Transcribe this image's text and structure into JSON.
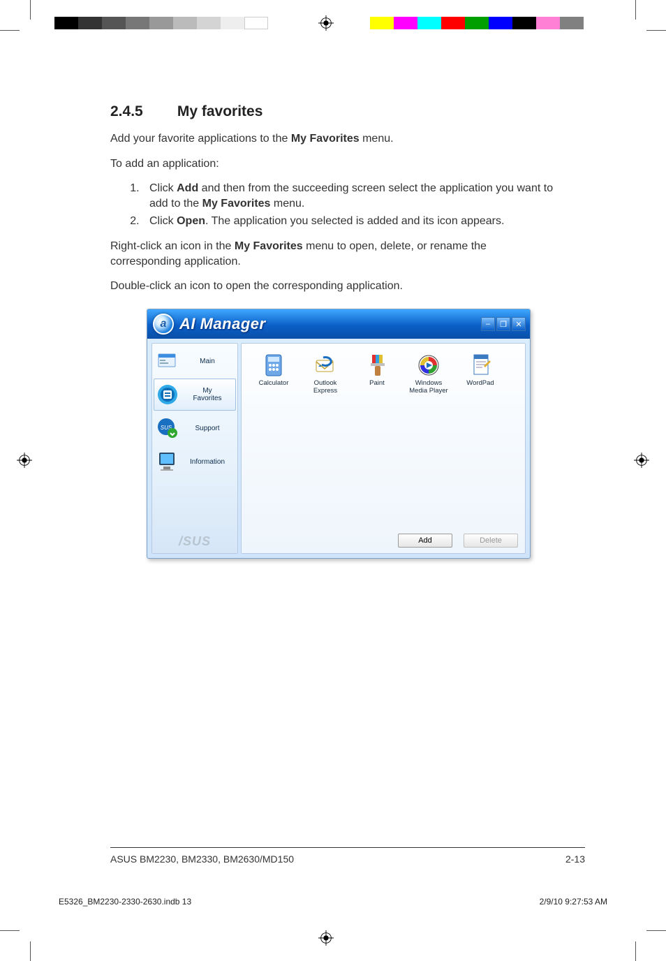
{
  "section": {
    "number": "2.4.5",
    "title": "My favorites"
  },
  "para1_pre": "Add your favorite applications to the ",
  "para1_bold": "My Favorites",
  "para1_post": " menu.",
  "para2": "To add an application:",
  "steps": {
    "s1_a": "Click ",
    "s1_b": "Add",
    "s1_c": " and then from the succeeding screen select the application you want to add to the ",
    "s1_d": "My Favorites",
    "s1_e": " menu.",
    "s2_a": "Click ",
    "s2_b": "Open",
    "s2_c": ". The application you selected is added and its icon appears."
  },
  "para3_a": "Right-click an icon in the ",
  "para3_b": "My Favorites",
  "para3_c": " menu to open, delete, or rename the corresponding application.",
  "para4": "Double-click an icon to open the corresponding application.",
  "window": {
    "title": "AI Manager",
    "logo_letter": "a",
    "brand": "/SUS",
    "sidebar": [
      {
        "label": "Main",
        "icon": "main-icon"
      },
      {
        "label": "My\nFavorites",
        "icon": "favorites-icon"
      },
      {
        "label": "Support",
        "icon": "support-icon"
      },
      {
        "label": "Information",
        "icon": "information-icon"
      }
    ],
    "apps": [
      {
        "label": "Calculator",
        "icon": "calculator-icon"
      },
      {
        "label": "Outlook\nExpress",
        "icon": "outlook-icon"
      },
      {
        "label": "Paint",
        "icon": "paint-icon"
      },
      {
        "label": "Windows\nMedia Player",
        "icon": "wmp-icon"
      },
      {
        "label": "WordPad",
        "icon": "wordpad-icon"
      }
    ],
    "buttons": {
      "add": "Add",
      "delete": "Delete"
    },
    "winbtns": {
      "min": "–",
      "max": "❐",
      "close": "✕"
    }
  },
  "footer": {
    "left": "ASUS BM2230, BM2330, BM2630/MD150",
    "right": "2-13"
  },
  "print": {
    "file": "E5326_BM2230-2330-2630.indb   13",
    "date": "2/9/10   9:27:53 AM"
  }
}
